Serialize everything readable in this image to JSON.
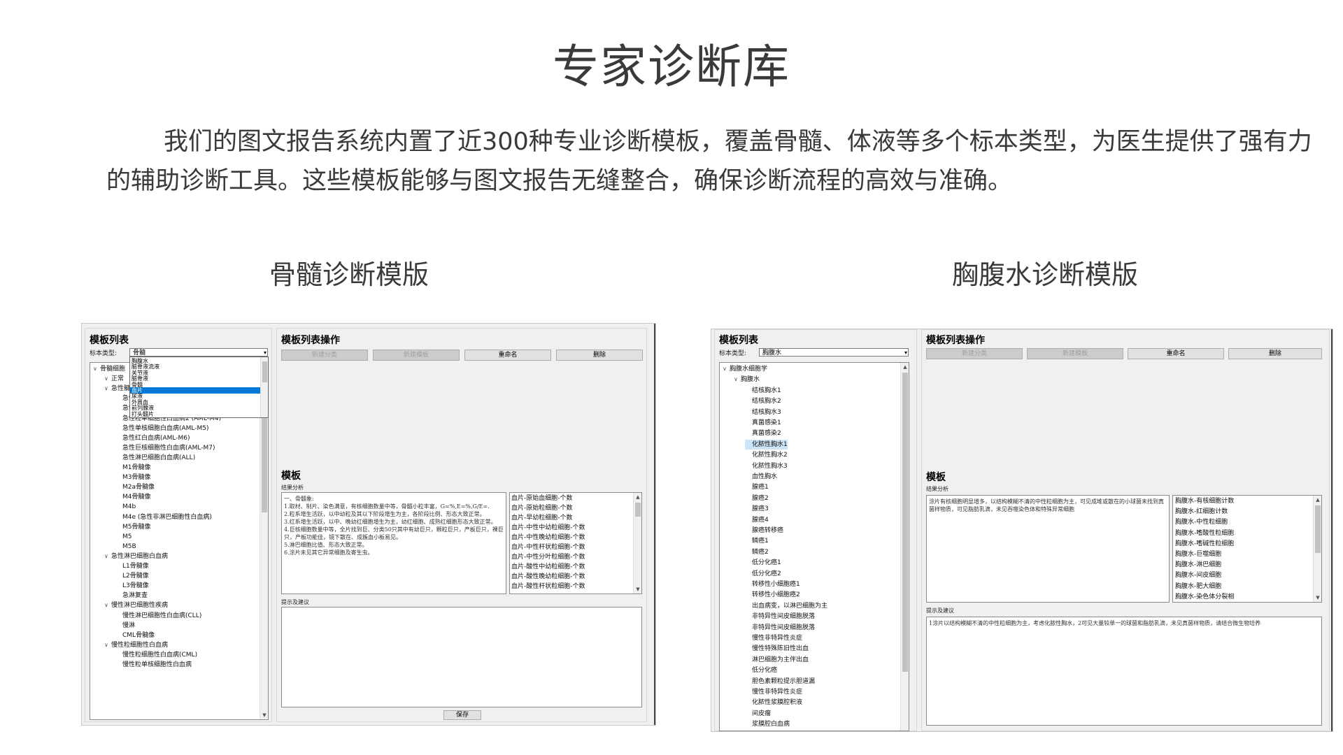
{
  "page": {
    "title": "专家诊断库",
    "intro": "我们的图文报告系统内置了近300种专业诊断模板，覆盖骨髓、体液等多个标本类型，为医生提供了强有力的辅助诊断工具。这些模板能够与图文报告无缝整合，确保诊断流程的高效与准确。",
    "section_bone": "骨髓诊断模版",
    "section_fluid": "胸腹水诊断模版"
  },
  "bone": {
    "list_title": "模板列表",
    "specimen_label": "标本类型:",
    "specimen_value": "骨髓",
    "ops_title": "模板列表操作",
    "buttons": [
      "新建分类",
      "新建模板",
      "重命名",
      "删除"
    ],
    "dropdown": [
      "胸腹水",
      "脑脊液流液",
      "关节液",
      "脑脊液",
      "骨髓",
      "血片",
      "尿液",
      "外周血",
      "前列腺液",
      "打头髓片"
    ],
    "dropdown_selected": 5,
    "tree": [
      {
        "label": "骨髓细胞",
        "level": 0,
        "chev": "∨"
      },
      {
        "label": "正常",
        "level": 1,
        "chev": "∨"
      },
      {
        "label": "急性髓系白血病",
        "level": 1,
        "chev": "∨"
      },
      {
        "label": "急性粒细胞白血病(AML)",
        "level": 2
      },
      {
        "label": "急性粒单细胞性白血病1 (AML-M4)",
        "level": 2
      },
      {
        "label": "急性粒单细胞性白血病2 (AML-M4)",
        "level": 2
      },
      {
        "label": "急性单核细胞白血病(AML-M5)",
        "level": 2
      },
      {
        "label": "急性红白血病(AML-M6)",
        "level": 2
      },
      {
        "label": "急性巨核细胞性白血病(AML-M7)",
        "level": 2
      },
      {
        "label": "急性淋巴细胞白血病(ALL)",
        "level": 2
      },
      {
        "label": "M1骨髓像",
        "level": 2
      },
      {
        "label": "M3骨髓像",
        "level": 2
      },
      {
        "label": "M2a骨髓像",
        "level": 2
      },
      {
        "label": "M4骨髓像",
        "level": 2
      },
      {
        "label": "M4b",
        "level": 2
      },
      {
        "label": "M4e (急性非淋巴细胞性白血病)",
        "level": 2
      },
      {
        "label": "M5骨髓像",
        "level": 2
      },
      {
        "label": "M5",
        "level": 2
      },
      {
        "label": "M5B",
        "level": 2
      },
      {
        "label": "急性淋巴细胞白血病",
        "level": 1,
        "chev": "∨"
      },
      {
        "label": "L1骨髓像",
        "level": 2
      },
      {
        "label": "L2骨髓像",
        "level": 2
      },
      {
        "label": "L3骨髓像",
        "level": 2
      },
      {
        "label": "急淋复查",
        "level": 2
      },
      {
        "label": "慢性淋巴细胞性疾病",
        "level": 1,
        "chev": "∨"
      },
      {
        "label": "慢性淋巴细胞性白血病(CLL)",
        "level": 2
      },
      {
        "label": "慢淋",
        "level": 2
      },
      {
        "label": "CML骨髓像",
        "level": 2
      },
      {
        "label": "慢性粒细胞性白血病",
        "level": 1,
        "chev": "∨"
      },
      {
        "label": "慢性粒细胞性白血病(CML)",
        "level": 2
      },
      {
        "label": "慢性粒单核细胞性白血病",
        "level": 2
      }
    ],
    "template_title": "模板",
    "result_label": "结果分析",
    "result_text": "一、骨髓象:\n1.取材、制片、染色满意，有核细胞数量中等，骨髓小粒丰富，G=%,E=%,G/E=.\n2.粒系增生活跃，以中幼粒及其以下阶段增生为主，各阶段比例、形态大致正常。\n3.红系增生活跃，以中、晚幼红细胞增生为主，幼红细胞、成熟红细胞形态大致正常。\n4.巨核细胞数量中等，全片找到巨、分类50只其中有幼巨只，颗粒巨只，产板巨只，裸巨只，产板功能佳，镜下散在、成簇血小板易见。\n5.淋巴细胞比值、形态大致正常。\n6.涂片未见其它异常细胞及寄生虫。",
    "cell_list": [
      "血片-原始血细胞-个数",
      "血片-原始粒细胞-个数",
      "血片-早幼粒细胞-个数",
      "血片-中性中幼粒细胞-个数",
      "血片-中性晚幼粒细胞-个数",
      "血片-中性杆状粒细胞-个数",
      "血片-中性分叶粒细胞-个数",
      "血片-酸性中幼粒细胞-个数",
      "血片-酸性晚幼粒细胞-个数",
      "血片-酸性杆状粒细胞-个数"
    ],
    "advice_label": "提示及建议",
    "save_button": "保存"
  },
  "fluid": {
    "list_title": "模板列表",
    "specimen_label": "标本类型:",
    "specimen_value": "胸腹水",
    "ops_title": "模板列表操作",
    "buttons": [
      "新建分类",
      "新建模板",
      "重命名",
      "删除"
    ],
    "tree": [
      {
        "label": "胸腹水细胞学",
        "level": 0,
        "chev": "∨"
      },
      {
        "label": "胸腹水",
        "level": 1,
        "chev": "∨"
      },
      {
        "label": "结核胸水1",
        "level": 2
      },
      {
        "label": "结核胸水2",
        "level": 2
      },
      {
        "label": "结核胸水3",
        "level": 2
      },
      {
        "label": "真菌感染1",
        "level": 2
      },
      {
        "label": "真菌感染2",
        "level": 2
      },
      {
        "label": "化脓性胸水1",
        "level": 2,
        "selected": true
      },
      {
        "label": "化脓性胸水2",
        "level": 2
      },
      {
        "label": "化脓性胸水3",
        "level": 2
      },
      {
        "label": "血性胸水",
        "level": 2
      },
      {
        "label": "腺癌1",
        "level": 2
      },
      {
        "label": "腺癌2",
        "level": 2
      },
      {
        "label": "腺癌3",
        "level": 2
      },
      {
        "label": "腺癌4",
        "level": 2
      },
      {
        "label": "腺癌转移癌",
        "level": 2
      },
      {
        "label": "鳞癌1",
        "level": 2
      },
      {
        "label": "鳞癌2",
        "level": 2
      },
      {
        "label": "低分化癌1",
        "level": 2
      },
      {
        "label": "低分化癌2",
        "level": 2
      },
      {
        "label": "转移性小细胞癌1",
        "level": 2
      },
      {
        "label": "转移性小细胞癌2",
        "level": 2
      },
      {
        "label": "出血病变，以淋巴细胞为主",
        "level": 2
      },
      {
        "label": "非特异性间皮细胞脱落",
        "level": 2
      },
      {
        "label": "非特异性间皮细胞脱落",
        "level": 2
      },
      {
        "label": "慢性非特异性炎症",
        "level": 2
      },
      {
        "label": "慢性特殊陈旧性出血",
        "level": 2
      },
      {
        "label": "淋巴细胞为主伴出血",
        "level": 2
      },
      {
        "label": "低分化癌",
        "level": 2
      },
      {
        "label": "胆色素颗粒提示胆道漏",
        "level": 2
      },
      {
        "label": "慢性非特异性炎症",
        "level": 2
      },
      {
        "label": "化脓性浆膜腔积液",
        "level": 2
      },
      {
        "label": "间皮瘤",
        "level": 2
      },
      {
        "label": "浆膜腔白血病",
        "level": 2
      }
    ],
    "template_title": "模板",
    "result_label": "结果分析",
    "result_text": "涂片有核细胞明显增多，以结构模糊不清的中性粒细胞为主，可见成堆或散在的小球菌未找到真菌样物质，可见脂肪乳滴，未见吞噬染色体和特殊异常细胞",
    "cell_list": [
      "胸腹水-有核细胞计数",
      "胸腹水-红细胞计数",
      "胸腹水-中性粒细胞",
      "胸腹水-嗜酸性粒细胞",
      "胸腹水-嗜碱性粒细胞",
      "胸腹水-巨噬细胞",
      "胸腹水-淋巴细胞",
      "胸腹水-间皮细胞",
      "胸腹水-肥大细胞",
      "胸腹水-染色体分裂相"
    ],
    "advice_label": "提示及建议",
    "advice_text": "1涂片以结构模糊不清的中性粒细胞为主，考虑化脓性胸水，2可见大量较单一的球菌和脂肪乳滴，未见真菌样物质，请结合微生物培养"
  }
}
